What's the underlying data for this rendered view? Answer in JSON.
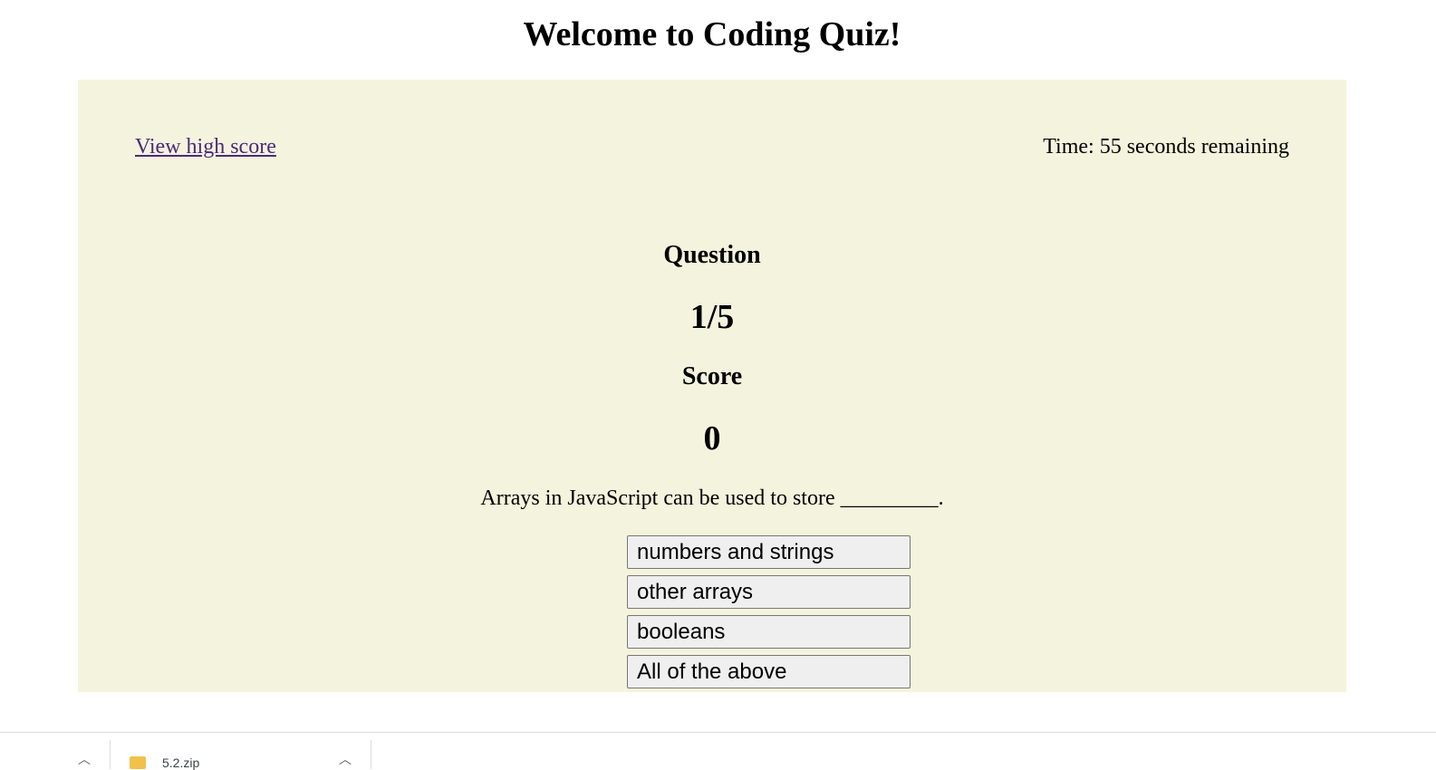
{
  "header": {
    "title": "Welcome to Coding Quiz!"
  },
  "quiz": {
    "high_score_link": "View high score",
    "timer": "Time: 55 seconds remaining",
    "question_label": "Question",
    "question_number": "1/5",
    "score_label": "Score",
    "score_value": "0",
    "question_text": "Arrays in JavaScript can be used to store _________.",
    "answers": [
      "numbers and strings",
      "other arrays",
      "booleans",
      "All of the above"
    ]
  },
  "download_shelf": {
    "file_name": "5.2.zip"
  },
  "colors": {
    "panel_background": "#f4f3dd",
    "link": "#4b2a7c",
    "button_background": "#efefef"
  }
}
